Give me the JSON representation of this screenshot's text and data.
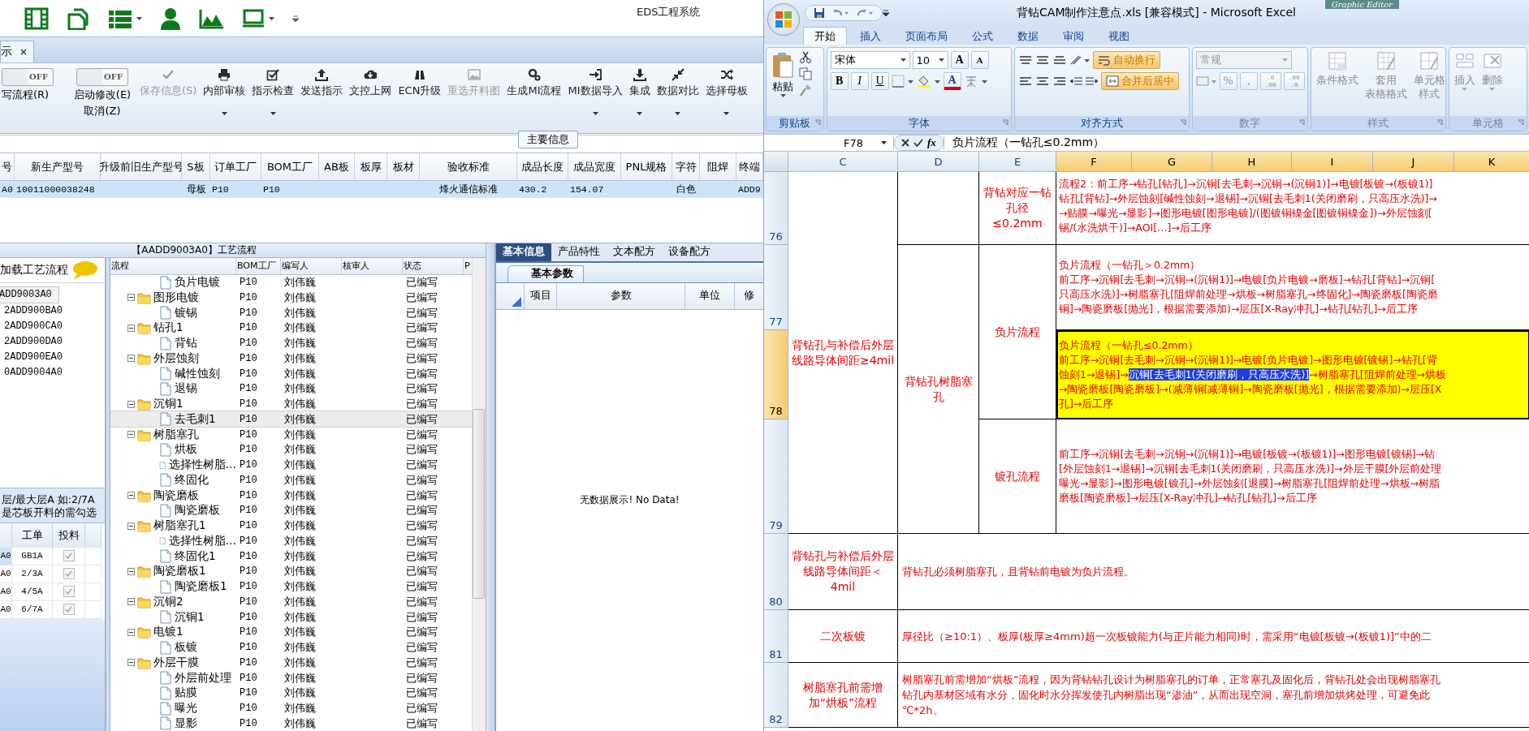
{
  "app": {
    "title": "EDS工程系统",
    "tab": {
      "label": "示",
      "selected": true
    },
    "toggles": [
      {
        "state": "OFF",
        "on": false,
        "labels": [
          "写流程(R)"
        ]
      },
      {
        "state": "OFF",
        "on": false,
        "labels": [
          "启动修改(E)",
          "取消(Z)"
        ]
      }
    ],
    "tools": [
      {
        "label": "保存信息(S)",
        "disabled": true,
        "dropdown": false
      },
      {
        "label": "内部审核",
        "disabled": false,
        "dropdown": true
      },
      {
        "label": "指示检查",
        "disabled": false,
        "dropdown": true
      },
      {
        "label": "发送指示",
        "disabled": false,
        "dropdown": false
      },
      {
        "label": "文控上网",
        "disabled": false,
        "dropdown": false
      },
      {
        "label": "ECN升级",
        "disabled": false,
        "dropdown": false
      },
      {
        "label": "重选开料图",
        "disabled": true,
        "dropdown": false
      },
      {
        "label": "生成MI流程",
        "disabled": false,
        "dropdown": false
      },
      {
        "label": "MI数据导入",
        "disabled": false,
        "dropdown": true
      },
      {
        "label": "集成",
        "disabled": false,
        "dropdown": true
      },
      {
        "label": "数据对比",
        "disabled": false,
        "dropdown": true
      },
      {
        "label": "选择母板",
        "disabled": false,
        "dropdown": true
      }
    ],
    "section_label": "主要信息",
    "main_table": {
      "columns": [
        "号",
        "新生产型号",
        "升级前旧生产型号",
        "S板",
        "订单工厂",
        "BOM工厂",
        "AB板",
        "板厚",
        "板材",
        "验收标准",
        "成品长度",
        "成品宽度",
        "PNL规格",
        "字符",
        "阻焊",
        "终端"
      ],
      "rows": [
        {
          "selected": true,
          "cells": [
            "A0",
            "10011000038248",
            "",
            "母板",
            "P10",
            "P10",
            "",
            "",
            "",
            "烽火通信标准",
            "430.2",
            "154.07",
            "",
            "白色",
            "",
            "ADD9"
          ]
        }
      ]
    },
    "flow_title": "【AADD9003A0】工艺流程",
    "flow_panel": {
      "load_label": "加载工艺流程",
      "items": [
        {
          "label": "ADD9003A0",
          "selected": true
        },
        {
          "label": "2ADD900BA0",
          "selected": false
        },
        {
          "label": "2ADD900CA0",
          "selected": false
        },
        {
          "label": "2ADD900DA0",
          "selected": false
        },
        {
          "label": "2ADD900EA0",
          "selected": false
        },
        {
          "label": "0ADD9004A0",
          "selected": false
        }
      ],
      "hint": [
        "层/最大层A 如:2/7A",
        "是芯板开料的需勾选"
      ],
      "grid": {
        "columns": [
          "工单",
          "投料"
        ],
        "rows": [
          {
            "code": "A0",
            "order": "GB1A",
            "checked": true,
            "selected": true
          },
          {
            "code": "A0",
            "order": "2/3A",
            "checked": true,
            "selected": false
          },
          {
            "code": "A0",
            "order": "4/5A",
            "checked": true,
            "selected": false
          },
          {
            "code": "A0",
            "order": "6/7A",
            "checked": true,
            "selected": false
          }
        ]
      }
    },
    "tree": {
      "columns": [
        "流程",
        "BOM工厂",
        "编写人",
        "核审人",
        "状态",
        "P"
      ],
      "nodes": [
        {
          "children": [
            {
              "label": "负片电镀",
              "bom": "P10",
              "author": "刘伟巍",
              "status": "已编写",
              "selected": false
            }
          ]
        },
        {
          "label": "图形电镀",
          "bom": "P10",
          "author": "刘伟巍",
          "status": "已编写",
          "selected": false,
          "expanded": true,
          "children": [
            {
              "label": "镀锡",
              "bom": "P10",
              "author": "刘伟巍",
              "status": "已编写",
              "selected": false
            }
          ]
        },
        {
          "label": "钻孔1",
          "bom": "P10",
          "author": "刘伟巍",
          "status": "已编写",
          "selected": false,
          "expanded": true,
          "children": [
            {
              "label": "背钻",
              "bom": "P10",
              "author": "刘伟巍",
              "status": "已编写",
              "selected": false
            }
          ]
        },
        {
          "label": "外层蚀刻",
          "bom": "P10",
          "author": "刘伟巍",
          "status": "已编写",
          "selected": false,
          "expanded": true,
          "children": [
            {
              "label": "碱性蚀刻",
              "bom": "P10",
              "author": "刘伟巍",
              "status": "已编写",
              "selected": false
            },
            {
              "label": "退锡",
              "bom": "P10",
              "author": "刘伟巍",
              "status": "已编写",
              "selected": false
            }
          ]
        },
        {
          "label": "沉铜1",
          "bom": "P10",
          "author": "刘伟巍",
          "status": "已编写",
          "selected": false,
          "expanded": true,
          "children": [
            {
              "label": "去毛刺1",
              "bom": "P10",
              "author": "刘伟巍",
              "status": "已编写",
              "selected": true
            }
          ]
        },
        {
          "label": "树脂塞孔",
          "bom": "P10",
          "author": "刘伟巍",
          "status": "已编写",
          "selected": false,
          "expanded": true,
          "children": [
            {
              "label": "烘板",
              "bom": "P10",
              "author": "刘伟巍",
              "status": "已编写",
              "selected": false
            },
            {
              "label": "选择性树脂…",
              "bom": "P10",
              "author": "刘伟巍",
              "status": "已编写",
              "selected": false
            },
            {
              "label": "终固化",
              "bom": "P10",
              "author": "刘伟巍",
              "status": "已编写",
              "selected": false
            }
          ]
        },
        {
          "label": "陶瓷磨板",
          "bom": "P10",
          "author": "刘伟巍",
          "status": "已编写",
          "selected": false,
          "expanded": true,
          "children": [
            {
              "label": "陶瓷磨板",
              "bom": "P10",
              "author": "刘伟巍",
              "status": "已编写",
              "selected": false
            }
          ]
        },
        {
          "label": "树脂塞孔1",
          "bom": "P10",
          "author": "刘伟巍",
          "status": "已编写",
          "selected": false,
          "expanded": true,
          "children": [
            {
              "label": "选择性树脂…",
              "bom": "P10",
              "author": "刘伟巍",
              "status": "已编写",
              "selected": false
            },
            {
              "label": "终固化1",
              "bom": "P10",
              "author": "刘伟巍",
              "status": "已编写",
              "selected": false
            }
          ]
        },
        {
          "label": "陶瓷磨板1",
          "bom": "P10",
          "author": "刘伟巍",
          "status": "已编写",
          "selected": false,
          "expanded": true,
          "children": [
            {
              "label": "陶瓷磨板1",
              "bom": "P10",
              "author": "刘伟巍",
              "status": "已编写",
              "selected": false
            }
          ]
        },
        {
          "label": "沉铜2",
          "bom": "P10",
          "author": "刘伟巍",
          "status": "已编写",
          "selected": false,
          "expanded": true,
          "children": [
            {
              "label": "沉铜1",
              "bom": "P10",
              "author": "刘伟巍",
              "status": "已编写",
              "selected": false
            }
          ]
        },
        {
          "label": "电镀1",
          "bom": "P10",
          "author": "刘伟巍",
          "status": "已编写",
          "selected": false,
          "expanded": true,
          "children": [
            {
              "label": "板镀",
              "bom": "P10",
              "author": "刘伟巍",
              "status": "已编写",
              "selected": false
            }
          ]
        },
        {
          "label": "外层干膜",
          "bom": "P10",
          "author": "刘伟巍",
          "status": "已编写",
          "selected": false,
          "expanded": true,
          "children": [
            {
              "label": "外层前处理",
              "bom": "P10",
              "author": "刘伟巍",
              "status": "已编写",
              "selected": false
            },
            {
              "label": "贴膜",
              "bom": "P10",
              "author": "刘伟巍",
              "status": "已编写",
              "selected": false
            },
            {
              "label": "曝光",
              "bom": "P10",
              "author": "刘伟巍",
              "status": "已编写",
              "selected": false
            },
            {
              "label": "显影",
              "bom": "P10",
              "author": "刘伟巍",
              "status": "已编写",
              "selected": false
            }
          ]
        }
      ]
    },
    "detail": {
      "tabs": [
        {
          "label": "基本信息",
          "selected": true
        },
        {
          "label": "产品特性",
          "selected": false
        },
        {
          "label": "文本配方",
          "selected": false
        },
        {
          "label": "设备配方",
          "selected": false
        }
      ],
      "subtab": "基本参数",
      "columns": [
        "项目",
        "参数",
        "单位",
        "修"
      ],
      "empty": "无数据展示! No Data!"
    }
  },
  "excel": {
    "title": "背钻CAM制作注意点.xls  [兼容模式] - Microsoft Excel",
    "background_window": "Graphic Editor",
    "tabs": [
      {
        "label": "开始",
        "selected": true
      },
      {
        "label": "插入",
        "selected": false
      },
      {
        "label": "页面布局",
        "selected": false
      },
      {
        "label": "公式",
        "selected": false
      },
      {
        "label": "数据",
        "selected": false
      },
      {
        "label": "审阅",
        "selected": false
      },
      {
        "label": "视图",
        "selected": false
      }
    ],
    "ribbon": {
      "clipboard": {
        "label": "剪贴板",
        "paste": "粘贴",
        "disabled": false
      },
      "font": {
        "label": "字体",
        "name": "宋体",
        "size": "10",
        "grow": "A",
        "shrink": "A",
        "bold": "B",
        "italic": "I",
        "underline": "U",
        "color_letter": "A",
        "disabled": false
      },
      "alignment": {
        "label": "对齐方式",
        "wrap": {
          "label": "自动换行",
          "on": true
        },
        "merge": {
          "label": "合并后居中",
          "on": true
        },
        "disabled": false
      },
      "number": {
        "label": "数字",
        "format": "常规",
        "percent": "%",
        "comma": ",",
        "increase": [
          ".0",
          ".00"
        ],
        "decrease": [
          ".00",
          ".0"
        ],
        "disabled": true
      },
      "styles": {
        "label": "样式",
        "buttons": [
          [
            "条件格式"
          ],
          [
            "套用",
            "表格格式"
          ],
          [
            "单元格",
            "样式"
          ]
        ],
        "disabled": true
      },
      "cells": {
        "label": "单元格",
        "buttons": [
          "插入",
          "删除"
        ],
        "disabled": true
      }
    },
    "name_box": "F78",
    "fx": "fx",
    "formula": "负片流程（一钻孔≤0.2mm）",
    "columns": [
      {
        "label": "C",
        "selected": false
      },
      {
        "label": "D",
        "selected": false
      },
      {
        "label": "E",
        "selected": false
      },
      {
        "label": "F",
        "selected": true
      },
      {
        "label": "G",
        "selected": true
      },
      {
        "label": "H",
        "selected": true
      },
      {
        "label": "I",
        "selected": true
      },
      {
        "label": "J",
        "selected": true
      },
      {
        "label": "K",
        "selected": true
      }
    ],
    "rows": [
      {
        "label": "76",
        "selected": false
      },
      {
        "label": "77",
        "selected": false
      },
      {
        "label": "78",
        "selected": true
      },
      {
        "label": "79",
        "selected": false
      },
      {
        "label": "80",
        "selected": false
      },
      {
        "label": "81",
        "selected": false
      },
      {
        "label": "82",
        "selected": false
      }
    ],
    "blocks": [
      {
        "c": "背钻孔与补偿后外层线路导体间距≥4mil",
        "groups": [
          {
            "items": [
              {
                "e": "背钻对应一钻孔径≤0.2mm",
                "cells": [
                  {
                    "selected": false,
                    "highlight": false,
                    "lines": [
                      "流程2：前工序→钻孔[钻孔]→沉铜[去毛刺→沉铜→(沉铜1)]→电镀[板镀→(板镀1)]",
                      "钻孔[背钻]→外层蚀刻[碱性蚀刻→退锡]→沉铜[去毛刺1(关闭磨刷，只高压水洗)]→",
                      "→贴膜→曝光→显影]→图形电镀[图形电镀]/(图镀铜镍金[图镀铜镍金])→外层蚀刻[",
                      "锡/(水洗烘干)]→AOI[…]→后工序"
                    ]
                  }
                ]
              }
            ]
          },
          {
            "d": "背钻孔树脂塞孔",
            "items": [
              {
                "e": "负片流程",
                "cells": [
                  {
                    "selected": false,
                    "highlight": false,
                    "lines": [
                      "负片流程（一钻孔＞0.2mm）",
                      "前工序→沉铜[去毛刺→沉铜→(沉铜1)]→电镀[负片电镀→磨板]→钻孔[背钻]→沉铜[",
                      "只高压水洗)]→树脂塞孔[阻焊前处理→烘板→树脂塞孔→终固化]→陶瓷磨板[陶瓷磨",
                      "铜]→陶瓷磨板[抛光]，根据需要添加)→层压[X-Ray冲孔]→钻孔[钻孔]→后工序"
                    ]
                  },
                  {
                    "selected": true,
                    "highlight": true,
                    "lines": [
                      "负片流程（一钻孔≤0.2mm）",
                      "前工序→沉铜[去毛刺→沉铜→(沉铜1)]→电镀[负片电镀]→图形电镀[镀锡]→钻孔[背",
                      {
                        "text": "蚀刻1→退锡]→",
                        "selected_text": "沉铜[去毛刺1(关闭磨刷，只高压水洗)]",
                        "text_after": "→树脂塞孔[阻焊前处理→烘板"
                      },
                      "→陶瓷磨板[陶瓷磨板]→(减薄铜[减薄铜]→陶瓷磨板[抛光]，根据需要添加)→层压[X",
                      "孔]→后工序"
                    ]
                  }
                ]
              },
              {
                "e": "镀孔流程",
                "cells": [
                  {
                    "selected": false,
                    "highlight": false,
                    "lines": [
                      "前工序→沉铜[去毛刺→沉铜→(沉铜1)]→电镀[板镀→(板镀1)]→图形电镀[镀锡]→钻",
                      "[外层蚀刻1→退锡]→沉铜[去毛刺1(关闭磨刷，只高压水洗)]→外层干膜[外层前处理",
                      "曝光→显影]→图形电镀[镀孔]→外层蚀刻[退膜]→树脂塞孔[阻焊前处理→烘板→树脂",
                      "磨板[陶瓷磨板]→层压[X-Ray冲孔]→钻孔[钻孔]→后工序"
                    ]
                  }
                ]
              }
            ]
          }
        ]
      },
      {
        "c": "背钻孔与补偿后外层线路导体间距＜4mil",
        "note": [
          "背钻孔必须树脂塞孔，且背钻前电镀为负片流程。"
        ]
      },
      {
        "c": "二次板镀",
        "note": [
          "厚径比（≥10:1）、板厚(板厚≥4mm)超一次板镀能力(与正片能力相同)时，需采用“电镀[板镀→(板镀1)]”中的二"
        ]
      },
      {
        "c": "树脂塞孔前需增加“烘板”流程",
        "note": [
          "树脂塞孔前需增加“烘板”流程，因为背钻钻孔设计为树脂塞孔的订单，正常塞孔及固化后，背钻孔处会出现树脂塞孔",
          "钻孔内基材区域有水分，固化时水分挥发使孔内树脂出现“渗油”，从而出现空洞，塞孔前增加烘烤处理，可避免此",
          "℃*2h。"
        ]
      }
    ]
  }
}
